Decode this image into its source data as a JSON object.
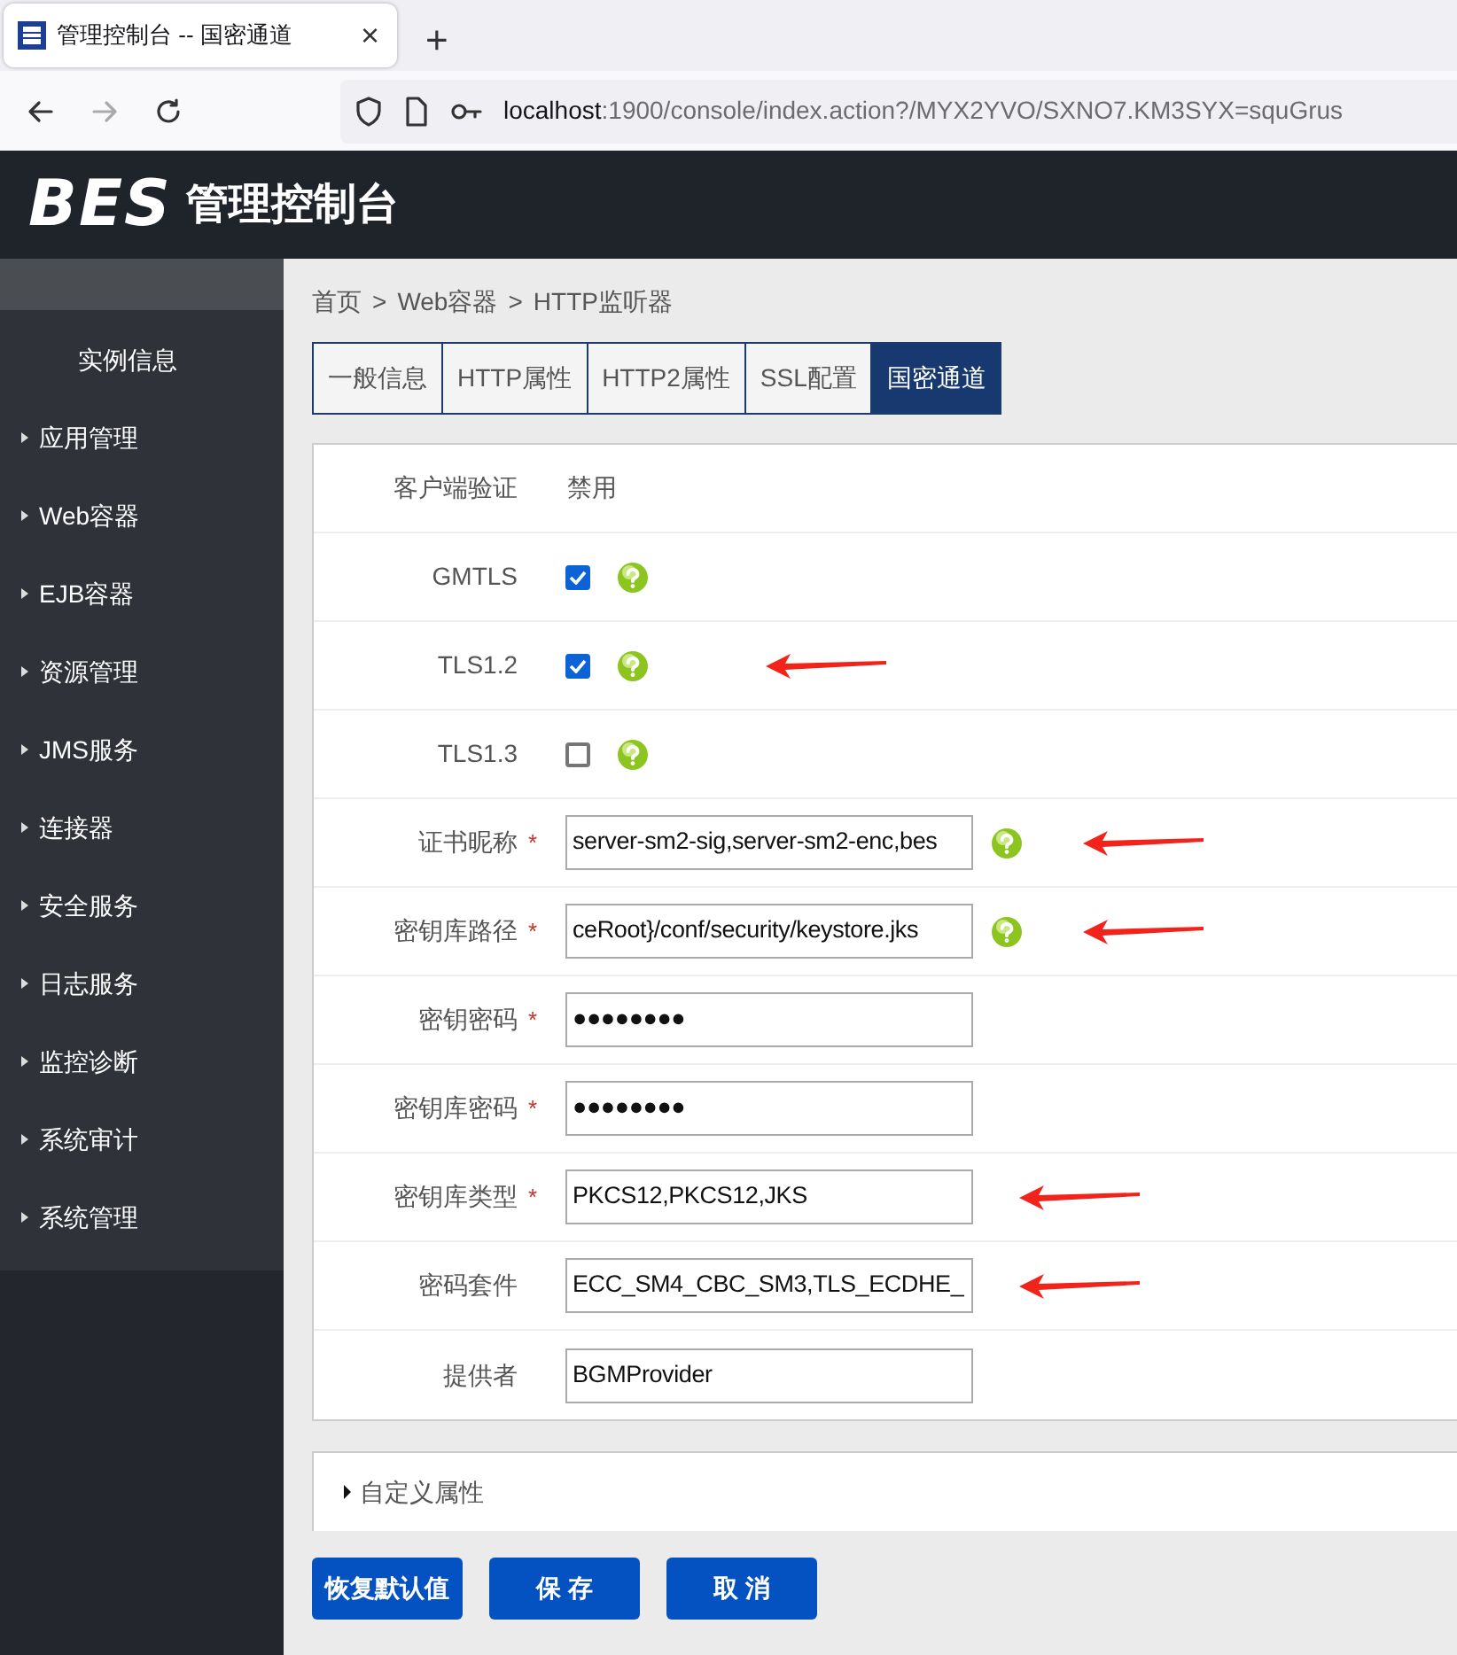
{
  "browser": {
    "tab_title": "管理控制台 -- 国密通道",
    "close": "×",
    "new_tab": "+",
    "url_host": "localhost",
    "url_rest": ":1900/console/index.action?/MYX2YVO/SXNO7.KM3SYX=squGrus",
    "forward_disabled": true
  },
  "header": {
    "logo": "BES",
    "title": "管理控制台"
  },
  "sidebar": {
    "items": [
      {
        "label": "实例信息",
        "expandable": false
      },
      {
        "label": "应用管理",
        "expandable": true
      },
      {
        "label": "Web容器",
        "expandable": true
      },
      {
        "label": "EJB容器",
        "expandable": true
      },
      {
        "label": "资源管理",
        "expandable": true
      },
      {
        "label": "JMS服务",
        "expandable": true
      },
      {
        "label": "连接器",
        "expandable": true
      },
      {
        "label": "安全服务",
        "expandable": true
      },
      {
        "label": "日志服务",
        "expandable": true
      },
      {
        "label": "监控诊断",
        "expandable": true
      },
      {
        "label": "系统审计",
        "expandable": true
      },
      {
        "label": "系统管理",
        "expandable": true
      }
    ]
  },
  "breadcrumb": [
    "首页",
    ">",
    "Web容器",
    ">",
    "HTTP监听器"
  ],
  "tabs": [
    {
      "label": "一般信息",
      "selected": false
    },
    {
      "label": "HTTP属性",
      "selected": false
    },
    {
      "label": "HTTP2属性",
      "selected": false
    },
    {
      "label": "SSL配置",
      "selected": false
    },
    {
      "label": "国密通道",
      "selected": true
    }
  ],
  "form": {
    "rows": [
      {
        "kind": "text",
        "label": "客户端验证",
        "value": "禁用",
        "help": false,
        "annotated": false
      },
      {
        "kind": "checkbox",
        "label": "GMTLS",
        "checked": true,
        "help": true,
        "annotated": false
      },
      {
        "kind": "checkbox",
        "label": "TLS1.2",
        "checked": true,
        "help": true,
        "annotated": true
      },
      {
        "kind": "checkbox",
        "label": "TLS1.3",
        "checked": false,
        "help": true,
        "annotated": false
      },
      {
        "kind": "input",
        "label": "证书昵称",
        "required": "*",
        "value": "server-sm2-sig,server-sm2-enc,bes",
        "help": true,
        "annotated": true
      },
      {
        "kind": "input",
        "label": "密钥库路径",
        "required": "*",
        "value": "ceRoot}/conf/security/keystore.jks",
        "help": true,
        "annotated": true
      },
      {
        "kind": "input",
        "label": "密钥密码",
        "required": "*",
        "value": "●●●●●●●●",
        "help": false,
        "annotated": false
      },
      {
        "kind": "input",
        "label": "密钥库密码",
        "required": "*",
        "value": "●●●●●●●●",
        "help": false,
        "annotated": false
      },
      {
        "kind": "input",
        "label": "密钥库类型",
        "required": "*",
        "value": "PKCS12,PKCS12,JKS",
        "help": false,
        "annotated": true
      },
      {
        "kind": "input",
        "label": "密码套件",
        "value": "ECC_SM4_CBC_SM3,TLS_ECDHE_",
        "help": false,
        "annotated": true
      },
      {
        "kind": "input",
        "label": "提供者",
        "value": "BGMProvider",
        "help": false,
        "annotated": false
      }
    ]
  },
  "custom_properties": {
    "label": "自定义属性",
    "expanded": false
  },
  "buttons": [
    "恢复默认值",
    "保 存",
    "取 消"
  ]
}
